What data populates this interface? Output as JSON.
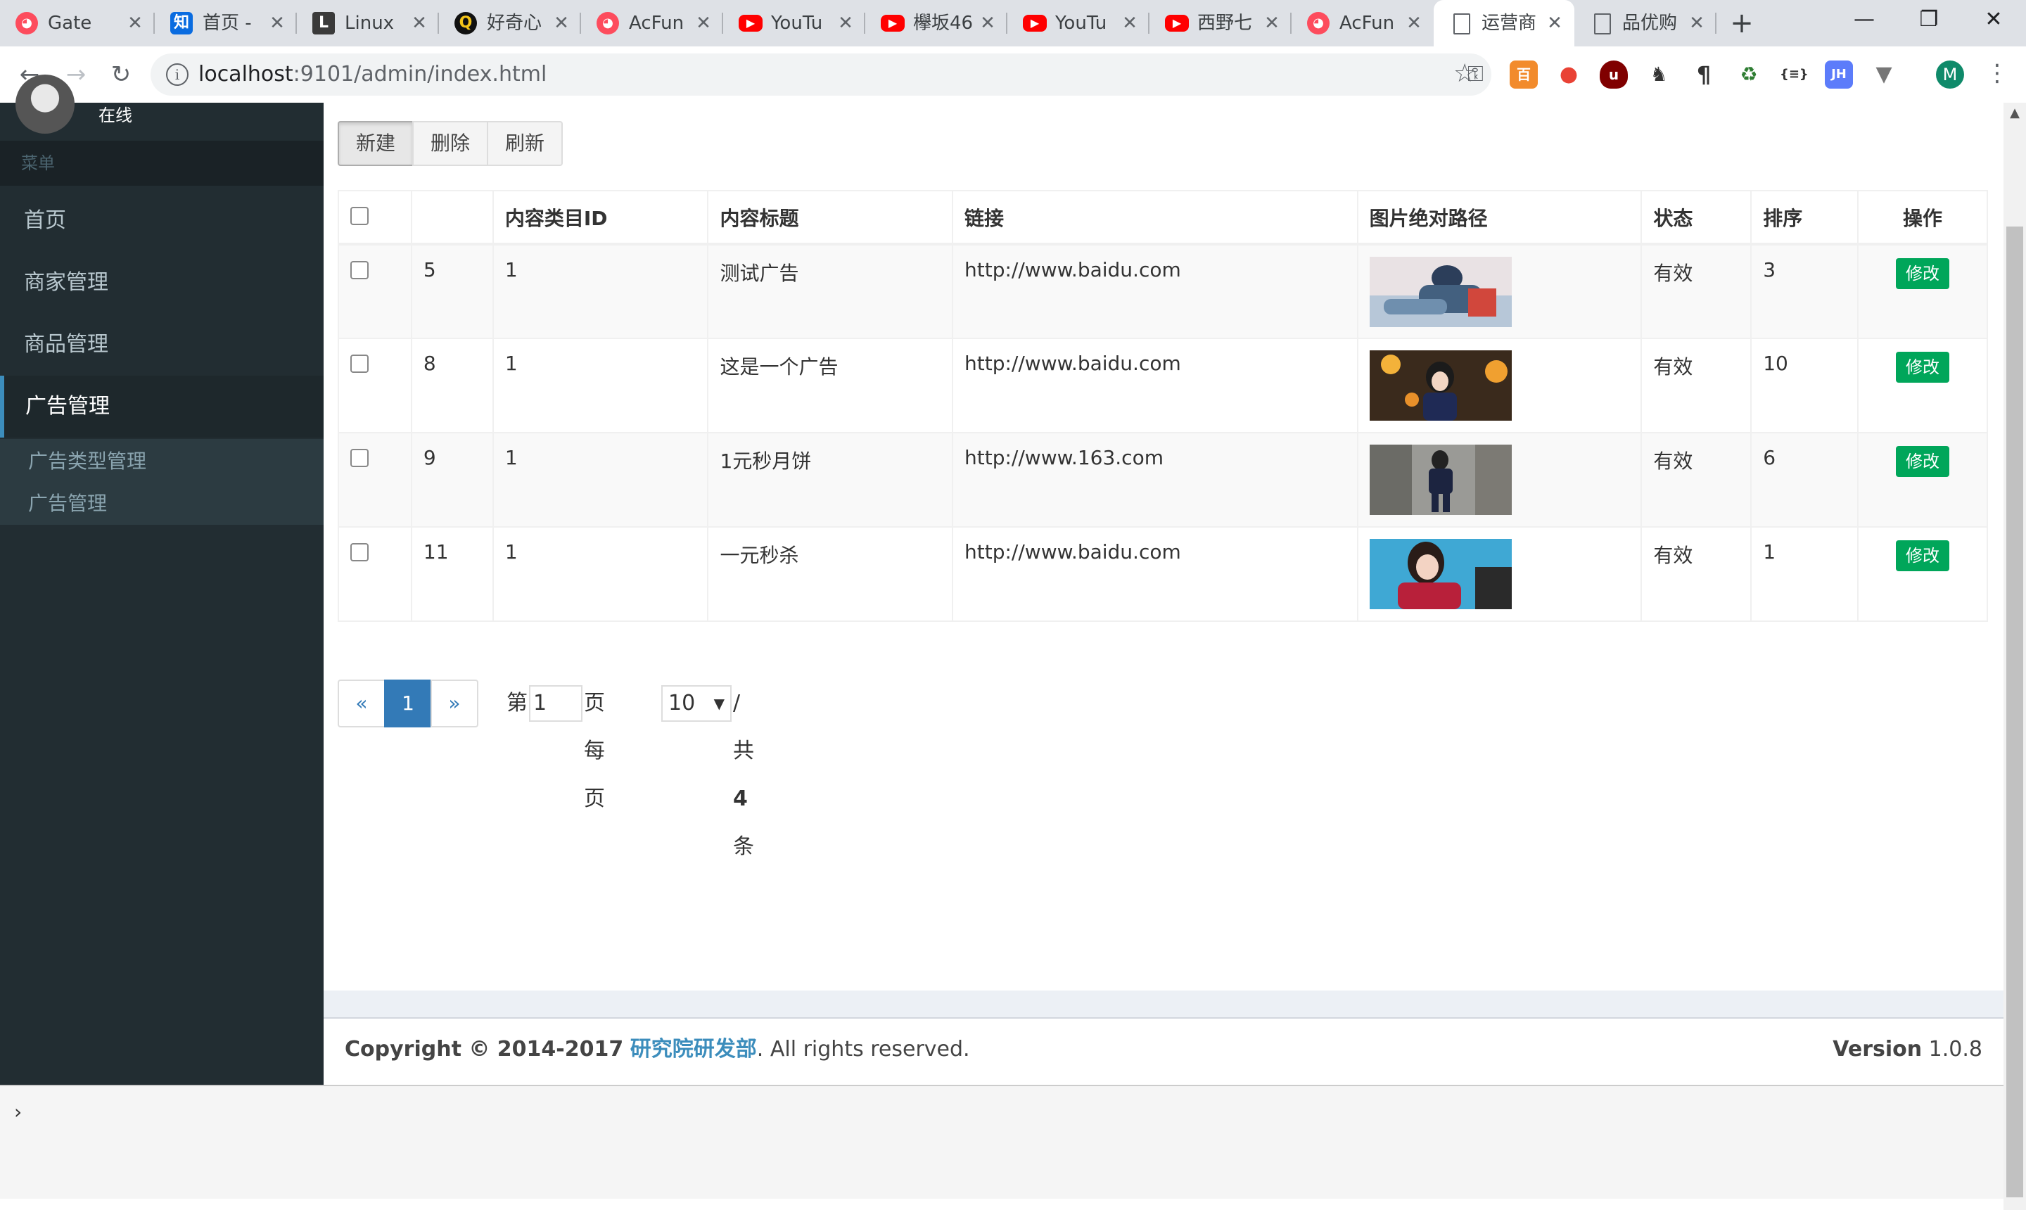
{
  "browser": {
    "tabs": [
      {
        "title": "Gate",
        "icon": "acfun-icon"
      },
      {
        "title": "首页 -",
        "icon": "zhihu-icon"
      },
      {
        "title": "Linux",
        "icon": "linux-icon"
      },
      {
        "title": "好奇心",
        "icon": "qdaily-icon"
      },
      {
        "title": "AcFun",
        "icon": "acfun-icon"
      },
      {
        "title": "YouTu",
        "icon": "youtube-icon"
      },
      {
        "title": "欅坂46",
        "icon": "youtube-icon"
      },
      {
        "title": "YouTu",
        "icon": "youtube-icon"
      },
      {
        "title": "西野七",
        "icon": "youtube-icon"
      },
      {
        "title": "AcFun",
        "icon": "acfun-icon"
      },
      {
        "title": "运营商",
        "icon": "document-icon",
        "active": true
      },
      {
        "title": "品优购",
        "icon": "document-icon"
      }
    ],
    "url_host": "localhost",
    "url_rest": ":9101/admin/index.html"
  },
  "sidebar": {
    "user_status": "在线",
    "menu_header": "菜单",
    "items": [
      {
        "label": "首页"
      },
      {
        "label": "商家管理"
      },
      {
        "label": "商品管理"
      },
      {
        "label": "广告管理",
        "active": true
      }
    ],
    "subitems": [
      {
        "label": "广告类型管理"
      },
      {
        "label": "广告管理"
      }
    ]
  },
  "toolbar": {
    "new_label": "新建",
    "delete_label": "删除",
    "refresh_label": "刷新"
  },
  "table": {
    "headers": [
      "",
      "",
      "内容类目ID",
      "内容标题",
      "链接",
      "图片绝对路径",
      "状态",
      "排序",
      "操作"
    ],
    "rows": [
      {
        "id": "5",
        "category_id": "1",
        "title": "测试广告",
        "url": "http://www.baidu.com",
        "status": "有效",
        "sort": "3",
        "action": "修改"
      },
      {
        "id": "8",
        "category_id": "1",
        "title": "这是一个广告",
        "url": "http://www.baidu.com",
        "status": "有效",
        "sort": "10",
        "action": "修改"
      },
      {
        "id": "9",
        "category_id": "1",
        "title": "1元秒月饼",
        "url": "http://www.163.com",
        "status": "有效",
        "sort": "6",
        "action": "修改"
      },
      {
        "id": "11",
        "category_id": "1",
        "title": "一元秒杀",
        "url": "http://www.baidu.com",
        "status": "有效",
        "sort": "1",
        "action": "修改"
      }
    ]
  },
  "pagination": {
    "prev": "«",
    "current": "1",
    "next": "»",
    "label_page_prefix": "第",
    "page_input_value": "1",
    "label_page_suffix": "页 每页",
    "page_size": "10",
    "label_total_prefix": "/共",
    "total": "4",
    "label_total_suffix": "条"
  },
  "footer": {
    "copyright": "Copyright © 2014-2017",
    "org": "研究院研发部",
    "rights": ". All rights reserved.",
    "version_label": "Version",
    "version": "1.0.8"
  },
  "console": {
    "prompt": "›"
  },
  "colors": {
    "sidebar_bg": "#222d32",
    "active_accent": "#3c8dbc",
    "edit_button": "#00a65a",
    "link_blue": "#337ab7"
  }
}
